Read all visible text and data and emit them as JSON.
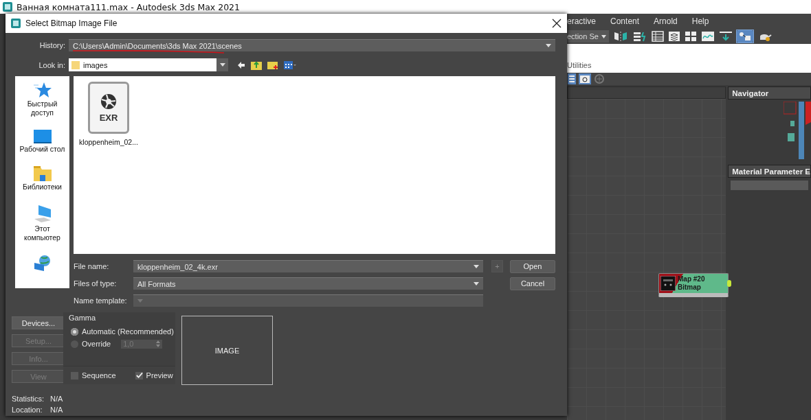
{
  "app": {
    "title": "Ванная комната111.max - Autodesk 3ds Max 2021"
  },
  "menu": [
    "eractive",
    "Content",
    "Arnold",
    "Help"
  ],
  "toolbar": {
    "selection_set": "ection Se"
  },
  "command_panel": {
    "tab": "Utilities"
  },
  "node_editor": {
    "panels": [
      {
        "title": "Navigator",
        "kind": "navigator"
      },
      {
        "title": "Material Parameter E",
        "kind": "parameters"
      }
    ],
    "node": {
      "title": "Map #20",
      "type": "Bitmap"
    }
  },
  "dialog": {
    "title": "Select Bitmap Image File",
    "history": {
      "label": "History:",
      "value": "C:\\Users\\Admin\\Documents\\3ds Max 2021\\scenes"
    },
    "look_in": {
      "label": "Look in:",
      "value": "images"
    },
    "places": [
      {
        "kind": "quick_access",
        "label": "Быстрый доступ"
      },
      {
        "kind": "desktop",
        "label": "Рабочий стол"
      },
      {
        "kind": "libraries",
        "label": "Библиотеки"
      },
      {
        "kind": "computer",
        "label": "Этот компьютер"
      },
      {
        "kind": "network"
      }
    ],
    "files": [
      {
        "name": "kloppenheim_02...",
        "badge": "EXR"
      }
    ],
    "fields": [
      {
        "label": "File name:",
        "value": "kloppenheim_02_4k.exr",
        "disabled": false
      },
      {
        "label": "Files of type:",
        "value": "All Formats",
        "disabled": false
      },
      {
        "label": "Name template:",
        "disabled": true
      }
    ],
    "add_button": {
      "label": "+",
      "disabled": true
    },
    "open_button": "Open",
    "cancel_button": "Cancel",
    "side_buttons": [
      {
        "label": "Devices...",
        "disabled": false
      },
      {
        "label": "Setup...",
        "disabled": true
      },
      {
        "label": "Info...",
        "disabled": true
      },
      {
        "label": "View",
        "disabled": true
      }
    ],
    "gamma": {
      "title": "Gamma",
      "options": [
        {
          "label": "Automatic (Recommended)",
          "selected": true
        },
        {
          "label": "Override",
          "selected": false
        }
      ],
      "override_value": "1,0",
      "override_disabled": true
    },
    "checkboxes": [
      {
        "label": "Sequence",
        "checked": false
      },
      {
        "label": "Preview",
        "checked": true
      }
    ],
    "preview_label": "IMAGE",
    "info": [
      {
        "label": "Statistics:",
        "value": "N/A"
      },
      {
        "label": "Location:",
        "value": "N/A"
      }
    ]
  }
}
